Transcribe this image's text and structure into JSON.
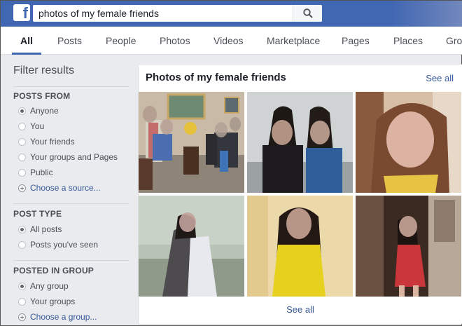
{
  "brand": {
    "logo_letter": "f"
  },
  "search": {
    "value": "photos of my female friends"
  },
  "tabs": [
    "All",
    "Posts",
    "People",
    "Photos",
    "Videos",
    "Marketplace",
    "Pages",
    "Places",
    "Gro"
  ],
  "sidebar": {
    "title": "Filter results",
    "posts_from": {
      "title": "POSTS FROM",
      "options": [
        "Anyone",
        "You",
        "Your friends",
        "Your groups and Pages",
        "Public"
      ],
      "add": "Choose a source..."
    },
    "post_type": {
      "title": "POST TYPE",
      "options": [
        "All posts",
        "Posts you've seen"
      ]
    },
    "posted_in_group": {
      "title": "POSTED IN GROUP",
      "options": [
        "Any group",
        "Your groups"
      ],
      "add": "Choose a group..."
    }
  },
  "results": {
    "title": "Photos of my female friends",
    "see_all_top": "See all",
    "see_all_bottom": "See all",
    "photos": [
      "photo-1",
      "photo-2",
      "photo-3",
      "photo-4",
      "photo-5",
      "photo-6"
    ]
  },
  "colors": {
    "brand": "#4267b2",
    "link": "#365899",
    "background": "#e9ebee"
  },
  "icons": [
    "facebook-logo-icon",
    "search-icon",
    "radio-icon",
    "add-circle-icon"
  ]
}
